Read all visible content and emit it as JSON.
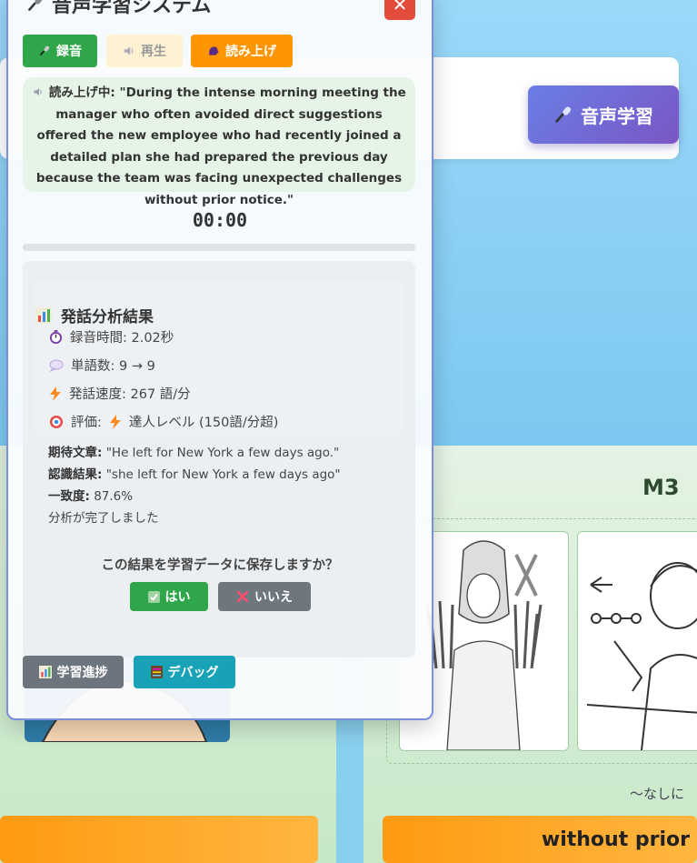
{
  "background": {
    "header_button": {
      "label": "音声学習",
      "icon": "microphone-icon"
    },
    "card_label": "M3",
    "hint_text": "～なしに",
    "bottom_button_right": "without prior"
  },
  "modal": {
    "title": "音声学習システム",
    "title_icon": "microphone-icon",
    "close_label": "✕",
    "buttons": {
      "record": "録音",
      "play": "再生",
      "read_aloud": "読み上げ"
    },
    "reading": {
      "prefix": "読み上げ中:",
      "text": "\"During the intense morning meeting the manager who often avoided direct suggestions offered the new employee who had recently joined a detailed plan she had prepared the previous day because the team was facing unexpected challenges without prior notice.\""
    },
    "timer": "00:00",
    "progress": 0,
    "analysis": {
      "title": "発話分析結果",
      "duration": "録音時間: 2.02秒",
      "word_count": "単語数: 9 → 9",
      "speed": "発話速度: 267 語/分",
      "rating_prefix": "評価:",
      "rating_value": "達人レベル (150語/分超)",
      "expected_label": "期待文章:",
      "expected_text": "\"He left for New York a few days ago.\"",
      "recognized_label": "認識結果:",
      "recognized_text": "\"she left for New York a few days ago\"",
      "match_label": "一致度:",
      "match_value": "87.6%",
      "complete": "分析が完了しました"
    },
    "save": {
      "question": "この結果を学習データに保存しますか？",
      "yes": "はい",
      "no": "いいえ"
    },
    "footer": {
      "progress_btn": "学習進捗",
      "debug_btn": "デバッグ"
    }
  },
  "colors": {
    "record": "#2fa64a",
    "read_aloud": "#ff9500",
    "close": "#e34b3d",
    "debug": "#17a2b8",
    "accent_purple": "#6a7ee6"
  }
}
